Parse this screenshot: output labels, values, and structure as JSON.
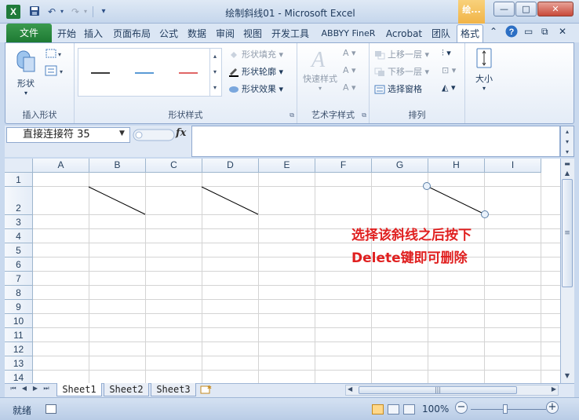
{
  "titlebar": {
    "app_icon": "X",
    "title": "绘制斜线01 - Microsoft Excel",
    "context_tab": "绘...",
    "icons": [
      "save-icon",
      "undo-icon",
      "redo-icon",
      "customize-icon"
    ]
  },
  "ribbon_tabs": {
    "file": "文件",
    "tabs": [
      "开始",
      "插入",
      "页面布局",
      "公式",
      "数据",
      "审阅",
      "视图",
      "开发工具",
      "ABBYY FineR",
      "Acrobat",
      "团队",
      "格式"
    ],
    "active": "格式"
  },
  "ribbon": {
    "insert_shape": {
      "label": "插入形状",
      "shape_btn": "形状"
    },
    "shape_styles": {
      "label": "形状样式",
      "fill": "形状填充",
      "outline": "形状轮廓",
      "effects": "形状效果",
      "line_colors": [
        "#3c3c3c",
        "#5b9bd5",
        "#e06666"
      ]
    },
    "wordart": {
      "label": "艺术字样式",
      "quick_styles": "快速样式"
    },
    "arrange": {
      "label": "排列",
      "bring_forward": "上移一层",
      "send_backward": "下移一层",
      "selection_pane": "选择窗格"
    },
    "size": {
      "label": "大小"
    }
  },
  "formula_bar": {
    "name_box": "直接连接符 35",
    "fx": "fx",
    "formula": ""
  },
  "grid": {
    "columns": [
      "A",
      "B",
      "C",
      "D",
      "E",
      "F",
      "G",
      "H",
      "I"
    ],
    "rows": [
      "1",
      "2",
      "3",
      "4",
      "5",
      "6",
      "7",
      "8",
      "9",
      "10",
      "11",
      "12",
      "13",
      "14"
    ]
  },
  "annotation": {
    "line1": "选择该斜线之后按下",
    "line2": "Delete键即可删除",
    "color": "#e02020"
  },
  "sheets": {
    "tabs": [
      "Sheet1",
      "Sheet2",
      "Sheet3"
    ],
    "active": "Sheet1"
  },
  "status": {
    "ready": "就绪",
    "zoom": "100%"
  }
}
